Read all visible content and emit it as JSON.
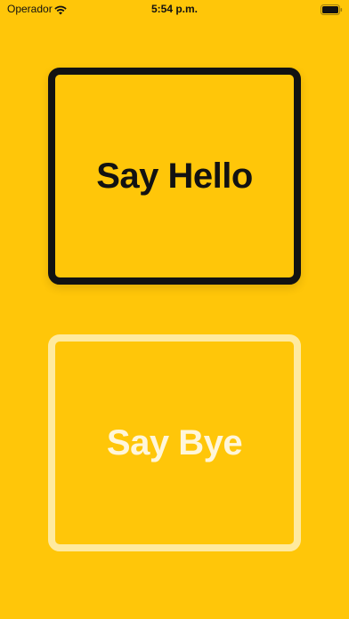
{
  "status_bar": {
    "carrier": "Operador",
    "time": "5:54 p.m.",
    "wifi_icon": "wifi-icon",
    "battery_icon": "battery-icon"
  },
  "buttons": {
    "hello": {
      "label": "Say Hello"
    },
    "bye": {
      "label": "Say Bye"
    }
  },
  "colors": {
    "background": "#FFC609",
    "selected_border": "#121212",
    "unselected_border": "#FFF0BA"
  }
}
